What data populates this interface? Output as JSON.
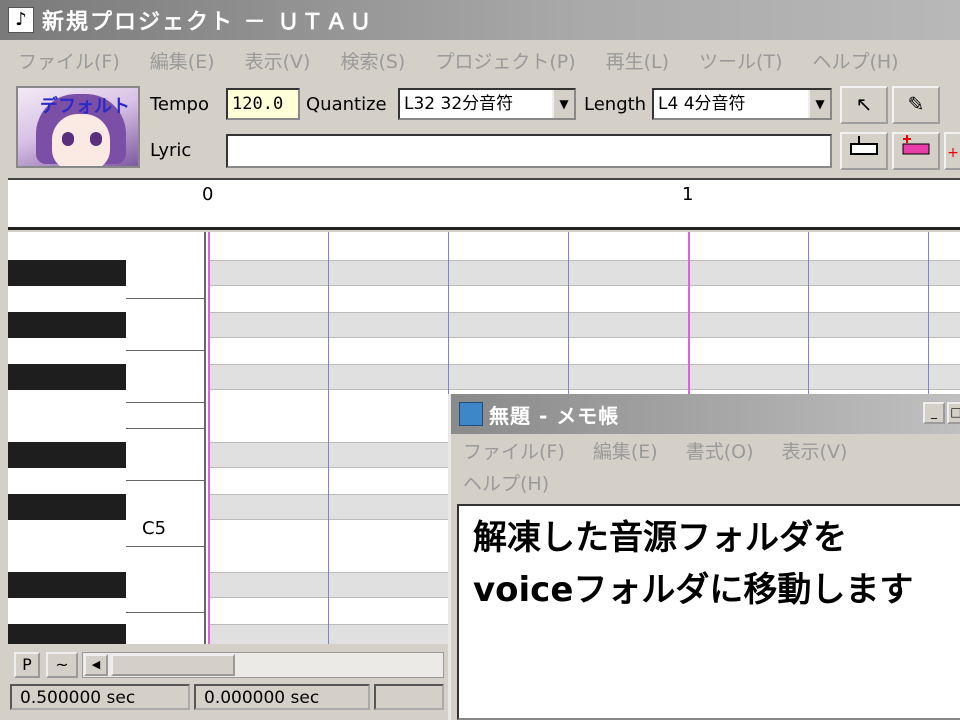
{
  "utau": {
    "title": "新規プロジェクト － ＵＴＡＵ",
    "menu": [
      "ファイル(F)",
      "編集(E)",
      "表示(V)",
      "検索(S)",
      "プロジェクト(P)",
      "再生(L)",
      "ツール(T)",
      "ヘルプ(H)"
    ],
    "avatar_label": "デフォルト",
    "tempo_label": "Tempo",
    "tempo_value": "120.0",
    "quantize_label": "Quantize",
    "quantize_value": "L32 32分音符",
    "length_label": "Length",
    "length_value": "L4  4分音符",
    "lyric_label": "Lyric",
    "lyric_value": "",
    "ruler": [
      "0",
      "1"
    ],
    "note_label": "C5",
    "p_button": "P",
    "tilde_button": "~",
    "status": [
      "0.500000 sec",
      "0.000000 sec"
    ]
  },
  "notepad": {
    "title": "無題 - メモ帳",
    "menu": [
      "ファイル(F)",
      "編集(E)",
      "書式(O)",
      "表示(V)",
      "ヘルプ(H)"
    ],
    "text_lines": [
      "解凍した音源フォルダを",
      "voiceフォルダに移動します"
    ]
  }
}
